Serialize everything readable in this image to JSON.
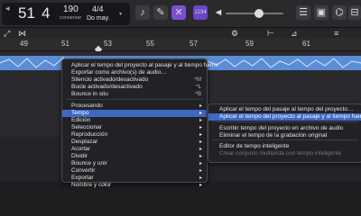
{
  "lcd": {
    "bar": "51",
    "beat": "4",
    "tempo": "190",
    "tempo_mode": "conservar",
    "signature": "4/4",
    "key": "Do may."
  },
  "toolbar": {
    "badge_label": "1234",
    "ruler_marks": [
      "49",
      "51",
      "53",
      "55",
      "57",
      "59",
      "61"
    ]
  },
  "menu_main": {
    "items": [
      {
        "label": "Aplicar el tempo del proyecto al pasaje y al tiempo fuerte",
        "shortcut": "",
        "submenu": false,
        "dim": false
      },
      {
        "label": "Exportar como archivo(s) de audio…",
        "shortcut": "",
        "submenu": false,
        "dim": false
      },
      {
        "label": "Silencio activado/desactivado",
        "shortcut": "^M",
        "submenu": false,
        "dim": false
      },
      {
        "label": "Bucle activado/desactivado",
        "shortcut": "^L",
        "submenu": false,
        "dim": false
      },
      {
        "label": "Bounce in situ",
        "shortcut": "^B",
        "submenu": false,
        "dim": false
      },
      {
        "label": "Procesando",
        "shortcut": "",
        "submenu": true,
        "dim": false
      },
      {
        "label": "Tempo",
        "shortcut": "",
        "submenu": true,
        "dim": false,
        "highlight": true
      },
      {
        "label": "Edición",
        "shortcut": "",
        "submenu": true,
        "dim": false
      },
      {
        "label": "Seleccionar",
        "shortcut": "",
        "submenu": true,
        "dim": false
      },
      {
        "label": "Reproducción",
        "shortcut": "",
        "submenu": true,
        "dim": false
      },
      {
        "label": "Desplazar",
        "shortcut": "",
        "submenu": true,
        "dim": false
      },
      {
        "label": "Acortar",
        "shortcut": "",
        "submenu": true,
        "dim": false
      },
      {
        "label": "Dividir",
        "shortcut": "",
        "submenu": true,
        "dim": false
      },
      {
        "label": "Bounce y unir",
        "shortcut": "",
        "submenu": true,
        "dim": false
      },
      {
        "label": "Convertir",
        "shortcut": "",
        "submenu": true,
        "dim": false
      },
      {
        "label": "Exportar",
        "shortcut": "",
        "submenu": true,
        "dim": false
      },
      {
        "label": "Nombre y color",
        "shortcut": "",
        "submenu": true,
        "dim": false
      }
    ]
  },
  "menu_tempo": {
    "items": [
      {
        "label": "Aplicar el tempo del pasaje al tempo del proyecto…",
        "dim": false
      },
      {
        "label": "Aplicar el tempo del proyecto al pasaje y al tiempo fuerte",
        "dim": false,
        "highlight": true
      },
      {
        "label": "Escribir tempo del proyecto en archivo de audio",
        "dim": false
      },
      {
        "label": "Eliminar el tempo de la grabación original",
        "dim": false
      },
      {
        "label": "Editor de tempo inteligente",
        "dim": false
      },
      {
        "label": "Crear conjunto multipista con tempo inteligente",
        "dim": true
      }
    ]
  }
}
